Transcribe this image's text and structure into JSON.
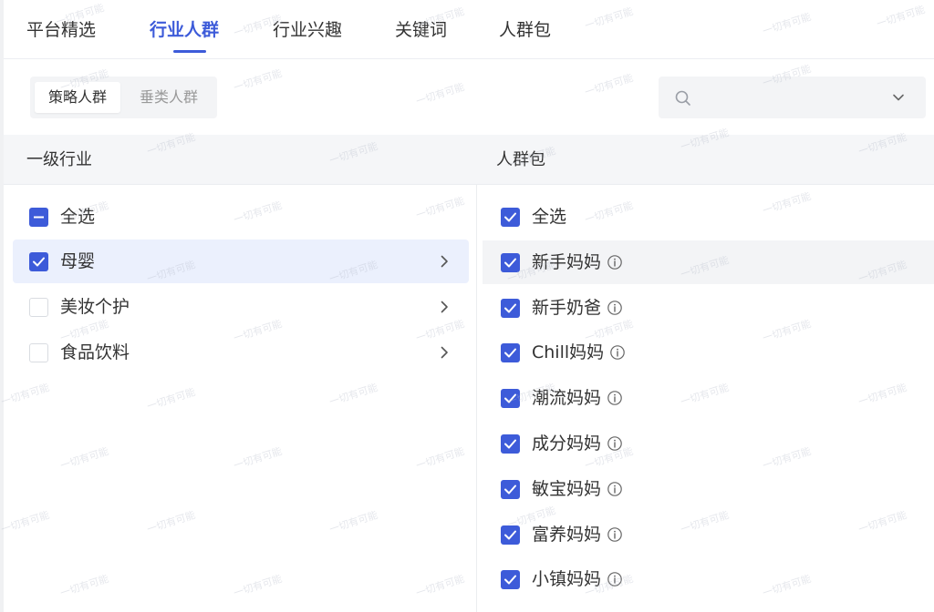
{
  "tabs": [
    {
      "label": "平台精选"
    },
    {
      "label": "行业人群"
    },
    {
      "label": "行业兴趣"
    },
    {
      "label": "关键词"
    },
    {
      "label": "人群包"
    }
  ],
  "segment": {
    "items": [
      {
        "label": "策略人群"
      },
      {
        "label": "垂类人群"
      }
    ]
  },
  "search": {
    "value": "",
    "placeholder": ""
  },
  "left_column": {
    "title": "一级行业",
    "items": [
      {
        "label": "全选",
        "state": "indeterminate"
      },
      {
        "label": "母婴",
        "state": "checked"
      },
      {
        "label": "美妆个护",
        "state": "unchecked"
      },
      {
        "label": "食品饮料",
        "state": "unchecked"
      }
    ]
  },
  "right_column": {
    "title": "人群包",
    "items": [
      {
        "label": "全选",
        "state": "checked"
      },
      {
        "label": "新手妈妈",
        "state": "checked"
      },
      {
        "label": "新手奶爸",
        "state": "checked"
      },
      {
        "label": "Chill妈妈",
        "state": "checked"
      },
      {
        "label": "潮流妈妈",
        "state": "checked"
      },
      {
        "label": "成分妈妈",
        "state": "checked"
      },
      {
        "label": "敏宝妈妈",
        "state": "checked"
      },
      {
        "label": "富养妈妈",
        "state": "checked"
      },
      {
        "label": "小镇妈妈",
        "state": "checked"
      }
    ]
  },
  "watermark": "一切有可能",
  "colors": {
    "accent": "#3d5bd9",
    "selected_row_bg": "#ebf0fd",
    "header_bg": "#f5f6f8"
  }
}
